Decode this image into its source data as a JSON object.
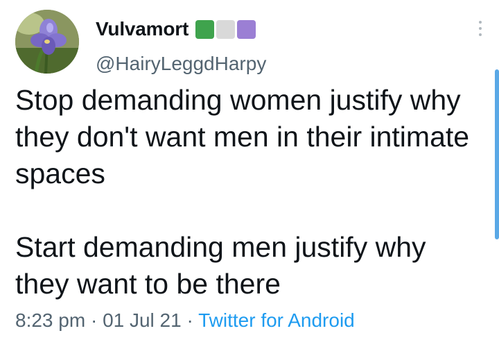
{
  "author": {
    "display_name": "Vulvamort",
    "handle": "@HairyLeggdHarpy",
    "flag_colors": [
      "#3fa34d",
      "#d9d9d9",
      "#9b7fd4"
    ]
  },
  "tweet": {
    "paragraphs": [
      "Stop demanding women justify why they don't want men in their intimate spaces",
      "Start demanding men justify why they want to be there"
    ]
  },
  "meta": {
    "time": "8:23 pm",
    "date": "01 Jul 21",
    "separator": "·",
    "source": "Twitter for Android"
  },
  "icons": {
    "avatar": "iris-flower-avatar",
    "more": "more-vertical-icon"
  }
}
